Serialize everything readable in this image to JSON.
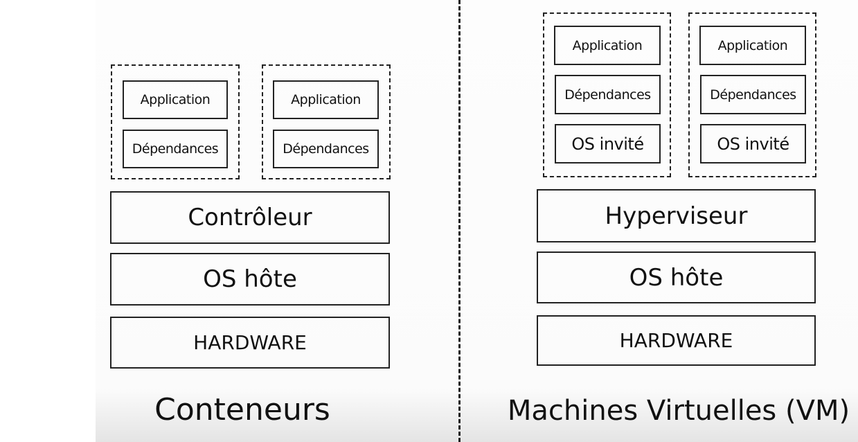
{
  "containers": {
    "title": "Conteneurs",
    "stacks": [
      {
        "application": "Application",
        "dependencies": "Dépendances"
      },
      {
        "application": "Application",
        "dependencies": "Dépendances"
      }
    ],
    "engine": "Contrôleur",
    "host_os": "OS hôte",
    "hardware": "HARDWARE"
  },
  "vms": {
    "title": "Machines Virtuelles (VM)",
    "stacks": [
      {
        "application": "Application",
        "dependencies": "Dépendances",
        "guest_os": "OS invité"
      },
      {
        "application": "Application",
        "dependencies": "Dépendances",
        "guest_os": "OS invité"
      }
    ],
    "hypervisor": "Hyperviseur",
    "host_os": "OS hôte",
    "hardware": "HARDWARE"
  }
}
